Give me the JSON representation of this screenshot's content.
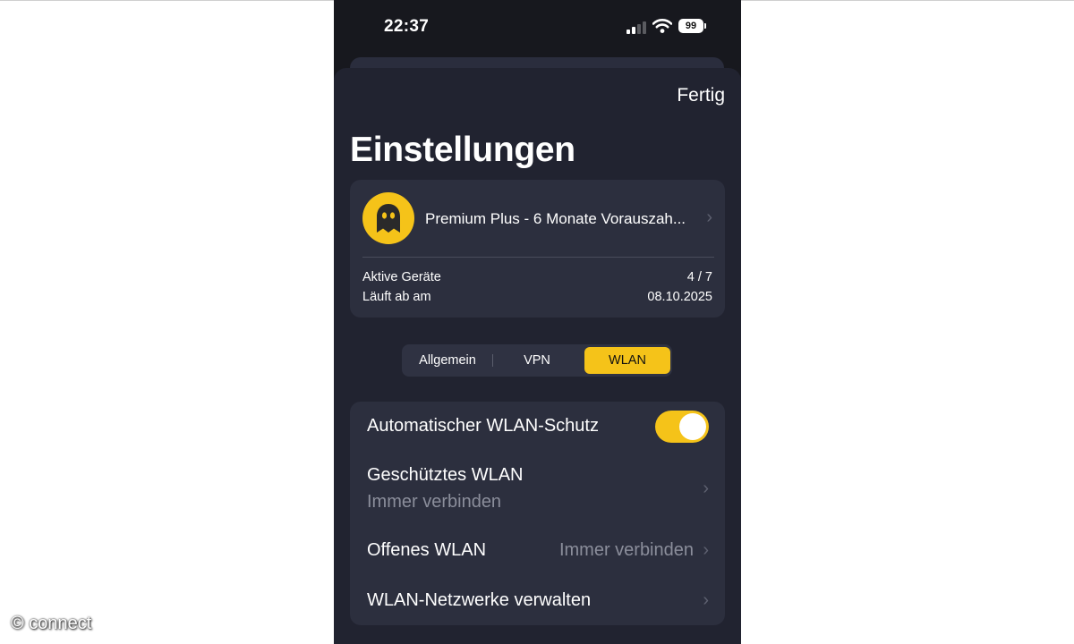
{
  "status_bar": {
    "time": "22:37",
    "battery": "99",
    "icons": [
      "cellular-signal-icon",
      "wifi-icon",
      "battery-icon"
    ]
  },
  "header": {
    "done_label": "Fertig",
    "title": "Einstellungen"
  },
  "plan_card": {
    "logo": "cyberghost-logo",
    "plan_name": "Premium Plus - 6 Monate Vorauszah...",
    "rows": [
      {
        "label": "Aktive Geräte",
        "value": "4 / 7"
      },
      {
        "label": "Läuft ab am",
        "value": "08.10.2025"
      }
    ]
  },
  "tabs": {
    "items": [
      "Allgemein",
      "VPN",
      "WLAN"
    ],
    "selected": "WLAN"
  },
  "wlan_settings": {
    "auto_protection": {
      "label": "Automatischer WLAN-Schutz",
      "enabled": true
    },
    "protected_wlan": {
      "label": "Geschütztes WLAN",
      "value": "Immer verbinden"
    },
    "open_wlan": {
      "label": "Offenes WLAN",
      "value": "Immer verbinden"
    },
    "manage_networks": {
      "label": "WLAN-Netzwerke verwalten"
    }
  },
  "watermark": "© connect",
  "colors": {
    "accent": "#f5c319",
    "sheet_background": "#212330",
    "card_background": "#2c2f3e",
    "secondary_text": "#8b8e9b"
  }
}
